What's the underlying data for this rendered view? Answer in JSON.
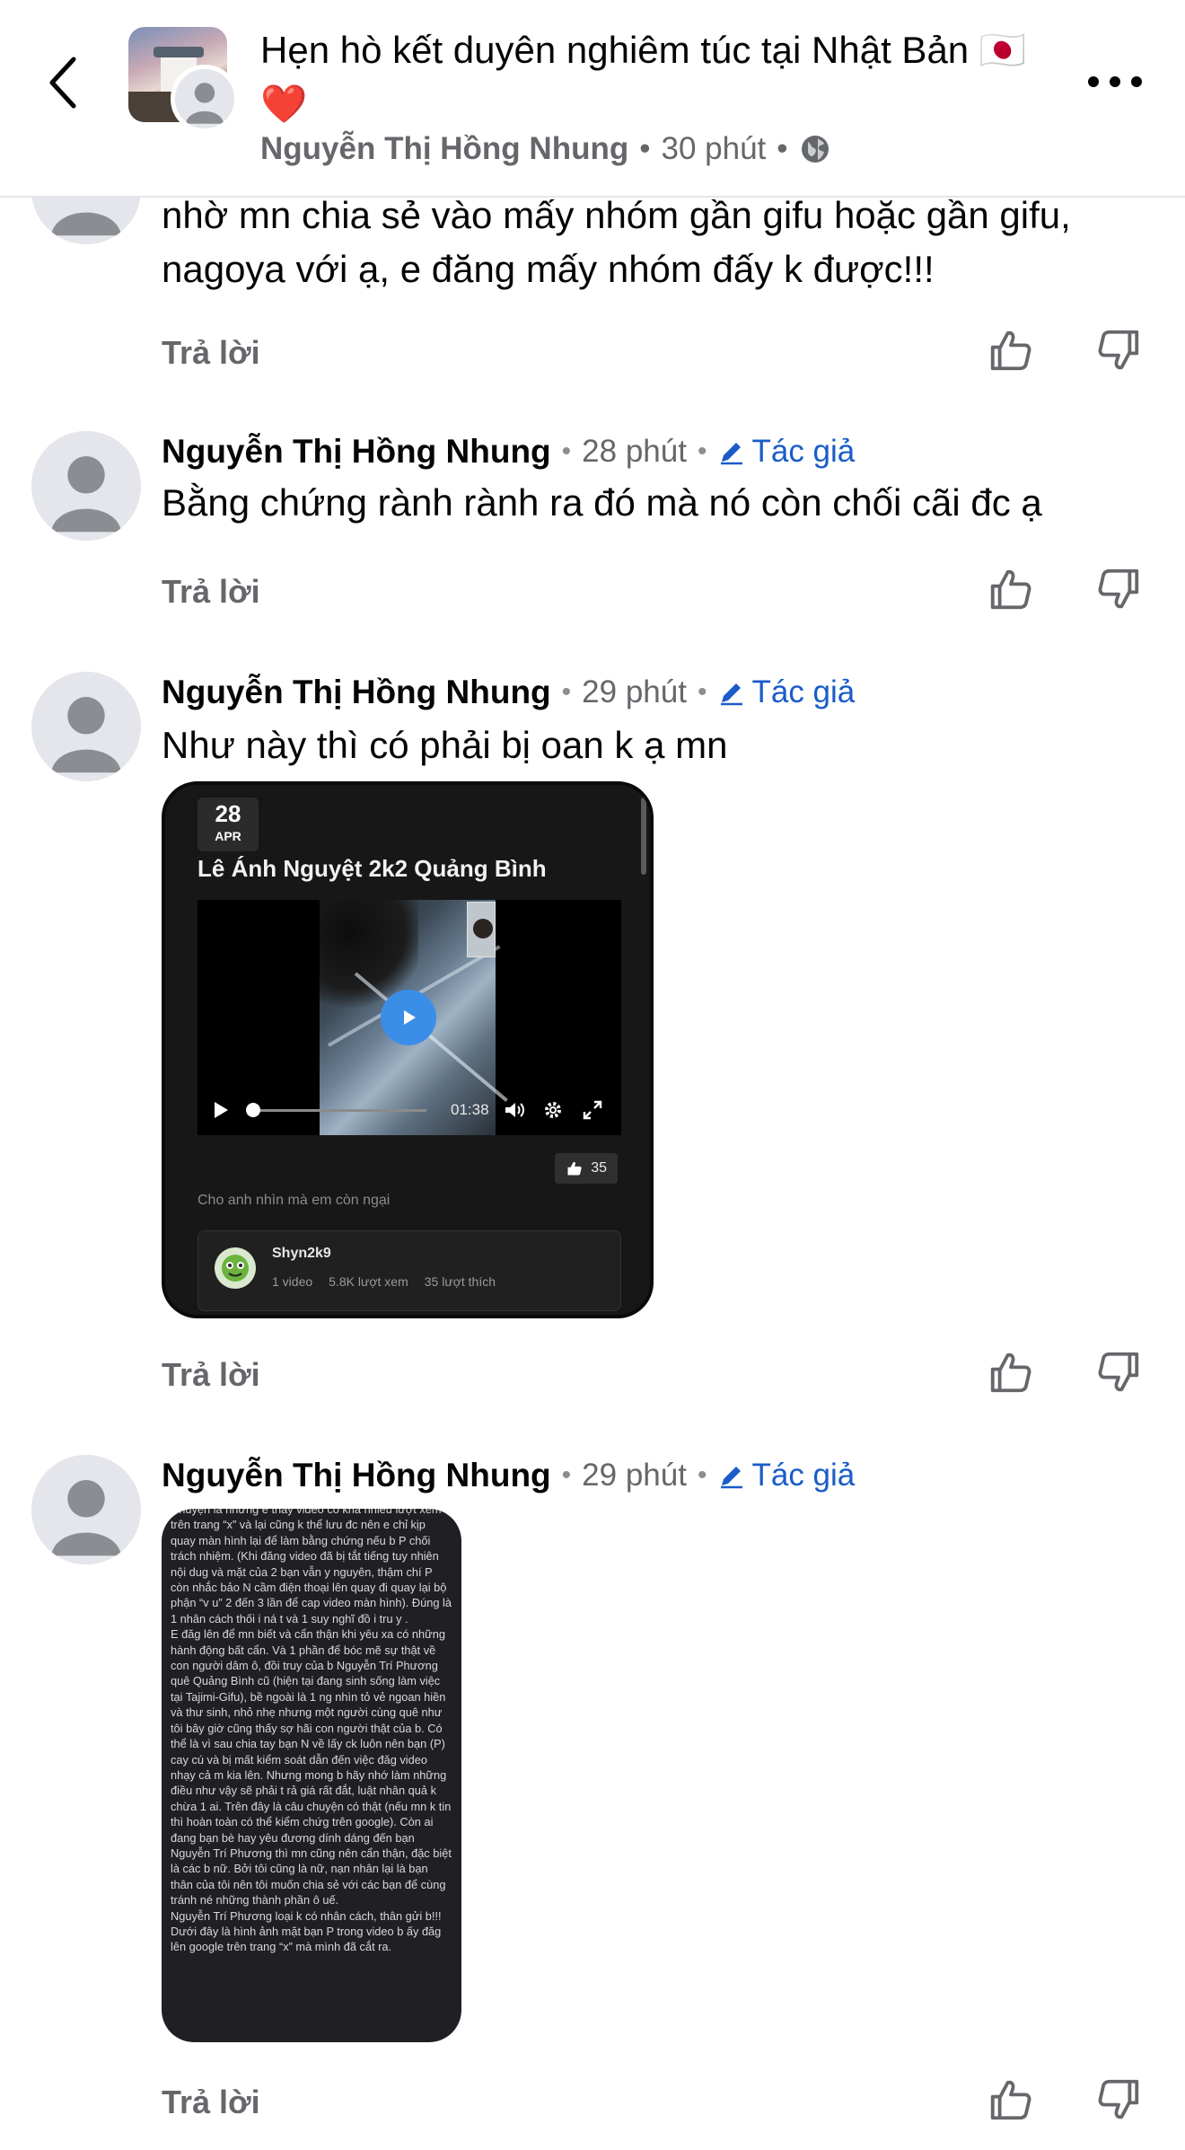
{
  "header": {
    "title": "Hẹn hò kết duyên nghiêm túc tại Nhật Bản 🇯🇵 ❤️",
    "author": "Nguyễn Thị Hồng Nhung",
    "time": "30 phút",
    "separator": "•",
    "privacy_icon": "globe-icon"
  },
  "comments": [
    {
      "text": "nhờ mn chia sẻ vào mấy nhóm gần gifu hoặc gần gifu, nagoya với ạ, e đăng mấy nhóm đấy k được!!!",
      "reply_label": "Trả lời"
    },
    {
      "author": "Nguyễn Thị Hồng Nhung",
      "time": "28 phút",
      "badge": "Tác giả",
      "text": "Bằng chứng rành rành ra đó mà nó còn chối cãi đc ạ",
      "reply_label": "Trả lời"
    },
    {
      "author": "Nguyễn Thị Hồng Nhung",
      "time": "29 phút",
      "badge": "Tác giả",
      "text": "Như này thì có phải bị oan k ạ mn",
      "reply_label": "Trả lời",
      "video": {
        "day": "28",
        "month": "APR",
        "title": "Lê Ánh Nguyệt 2k2 Quảng Bình",
        "duration": "01:38",
        "likes": "35",
        "caption": "Cho anh nhìn mà em còn ngại",
        "channel_name": "Shyn2k9",
        "videos": "1 video",
        "views": "5.8K lượt xem",
        "channel_likes": "35 lượt thích"
      }
    },
    {
      "author": "Nguyễn Thị Hồng Nhung",
      "time": "29 phút",
      "badge": "Tác giả",
      "reply_label": "Trả lời",
      "image_text": "Chuyện là nhưng e thấy video có khá nhiều lượt xem trên trang “x” và lại cũng k thể lưu đc nên e chỉ kịp quay màn hình lại để làm bằng chứng nếu b P chối trách nhiệm. (Khi đăng video đã bị tắt tiếng tuy nhiên nội dug và mặt của 2 bạn vẫn y nguyên, thậm chí P còn nhắc bảo N cầm điện thoại lên quay đi quay lại bộ phận “v u” 2 đến 3 lần để cap video màn hình). Đúng là 1 nhân cách thối i ná t và 1 suy nghĩ đồ i tru y .\nE đăg lên để mn biết và cẩn thận khi yêu xa có những hành động bất cẩn. Và 1 phần để bóc mẽ sự thật về con người dâm ô, đồi truy của b Nguyễn Trí Phương quê Quảng Bình cũ (hiện tại đang sinh sống làm việc tại Tajimi-Gifu), bề ngoài là 1 ng nhìn tỏ vẻ ngoan hiền và thư sinh, nhỏ nhẹ nhưng một người cùng quê như tôi bây giờ cũng thấy sợ hãi con người thật của b.  Có thể là vì sau chia tay bạn N về lấy ck luôn nên bạn (P) cay cú và bị mất  kiểm soát dẫn đến việc đăg video nhạy cả m kia lên. Nhưng mong b hãy nhớ làm những điều như vậy sẽ phải t rả giá rất đắt, luật nhân quả k chừa 1 ai. Trên đây là câu chuyện có thật (nếu mn k tin thì hoàn toàn có thể kiểm chứg trên google). Còn ai đang bạn bè hay yêu đương dính dáng đến bạn Nguyễn Trí Phương thì mn cũng nên cẩn thận, đặc biệt là các b nữ. Bởi tôi cũng là nữ, nạn nhân lại là bạn thân của tôi nên tôi muốn chia sẻ với các bạn để cùng tránh né những thành phần ô uế.\nNguyễn Trí Phương loại k có nhân cách, thân gửi b!!!\nDưới đây là hình ảnh mặt bạn P trong video b ấy đăg lên google trên trang “x” mà mình đã cắt ra."
    }
  ],
  "colors": {
    "badge_blue": "#1a5cc8",
    "meta_gray": "#65676b",
    "avatar_gray": "#e4e6eb"
  }
}
